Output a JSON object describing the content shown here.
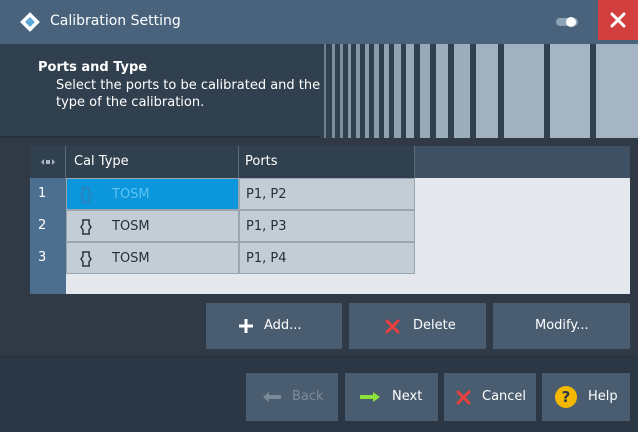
{
  "window": {
    "title": "Calibration Setting"
  },
  "header": {
    "title": "Ports and Type",
    "description": "Select the ports to be calibrated and the type of the calibration."
  },
  "table": {
    "columns": [
      "Cal Type",
      "Ports"
    ],
    "rows": [
      {
        "index": "1",
        "cal_type": "TOSM",
        "ports": "P1, P2",
        "selected": true
      },
      {
        "index": "2",
        "cal_type": "TOSM",
        "ports": "P1, P3",
        "selected": false
      },
      {
        "index": "3",
        "cal_type": "TOSM",
        "ports": "P1, P4",
        "selected": false
      }
    ]
  },
  "actions": {
    "add_label": "Add...",
    "delete_label": "Delete",
    "modify_label": "Modify..."
  },
  "footer": {
    "back_label": "Back",
    "next_label": "Next",
    "cancel_label": "Cancel",
    "help_label": "Help"
  },
  "colors": {
    "title_bar": "#4a637c",
    "close_button": "#d33f3f",
    "selected_cell": "#0c96dc",
    "next_arrow": "#8de23a",
    "help_icon": "#f5b800"
  },
  "icons": {
    "logo": "rohde-schwarz-logo",
    "toggle": "toggle-switch-icon",
    "close": "close-icon",
    "cal_type": "calibration-kit-icon",
    "add": "plus-icon",
    "delete": "x-icon",
    "back": "arrow-left-icon",
    "next": "arrow-right-icon",
    "cancel": "x-icon",
    "help": "question-icon"
  }
}
